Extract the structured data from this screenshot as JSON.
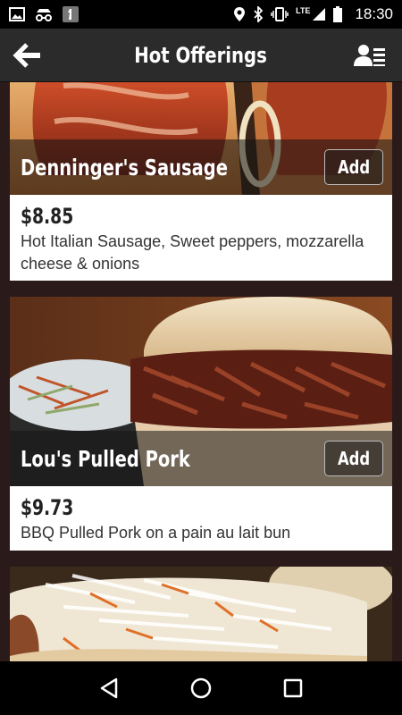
{
  "status_bar": {
    "time": "18:30",
    "network": "LTE",
    "icons_left": [
      "image-icon",
      "incognito-icon",
      "notification-one-icon"
    ],
    "icons_right": [
      "location-icon",
      "bluetooth-icon",
      "vibrate-icon",
      "signal-icon",
      "battery-icon"
    ]
  },
  "app_bar": {
    "title": "Hot Offerings",
    "back_icon": "arrow-left-icon",
    "profile_icon": "account-list-icon"
  },
  "items": [
    {
      "name": "Denninger's Sausage",
      "add_label": "Add",
      "price": "$8.85",
      "description": "Hot Italian Sausage, Sweet peppers, mozzarella cheese & onions"
    },
    {
      "name": "Lou's Pulled Pork",
      "add_label": "Add",
      "price": "$9.73",
      "description": "BBQ Pulled Pork on a pain au lait bun"
    },
    {
      "name": "",
      "add_label": "",
      "price": "",
      "description": ""
    }
  ],
  "nav_bar": {
    "buttons": [
      "back-triangle-icon",
      "home-circle-icon",
      "recents-square-icon"
    ]
  }
}
